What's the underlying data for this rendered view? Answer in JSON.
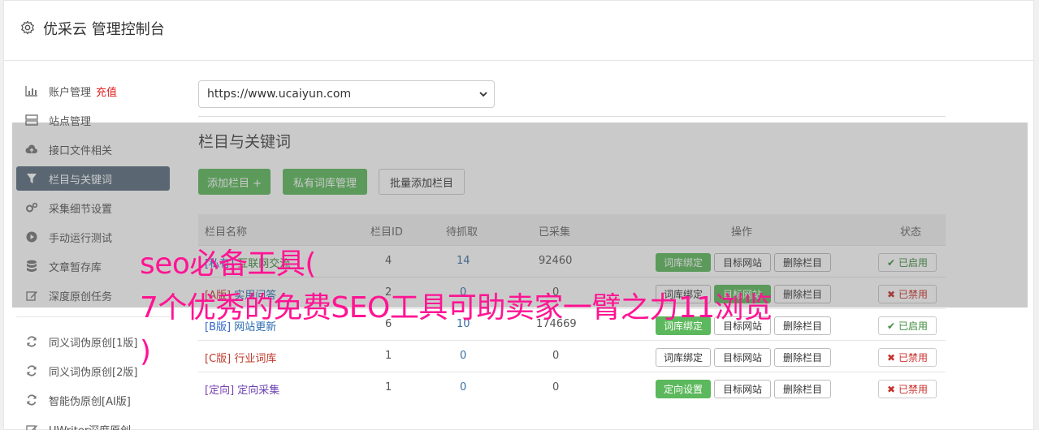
{
  "header": {
    "title": "优采云 管理控制台"
  },
  "sidebar": {
    "items": [
      {
        "label": "账户管理",
        "extra": "充值",
        "icon": "bar-chart-icon"
      },
      {
        "label": "站点管理",
        "icon": "server-icon"
      },
      {
        "label": "接口文件相关",
        "icon": "cloud-upload-icon"
      },
      {
        "label": "栏目与关键词",
        "icon": "filter-icon",
        "active": true
      },
      {
        "label": "采集细节设置",
        "icon": "gears-icon"
      },
      {
        "label": "手动运行测试",
        "icon": "play-circle-icon"
      },
      {
        "label": "文章暂存库",
        "icon": "database-icon"
      },
      {
        "label": "深度原创任务",
        "icon": "edit-icon"
      },
      {
        "label": "同义词伪原创[1版]",
        "icon": "refresh-icon"
      },
      {
        "label": "同义词伪原创[2版]",
        "icon": "refresh-icon"
      },
      {
        "label": "智能伪原创[AI版]",
        "icon": "refresh-icon"
      },
      {
        "label": "UWriter深度原创",
        "icon": "edit-icon"
      }
    ]
  },
  "site_select": {
    "value": "https://www.ucaiyun.com"
  },
  "section": {
    "title": "栏目与关键词",
    "buttons": {
      "add": "添加栏目 +",
      "private": "私有词库管理",
      "batch": "批量添加栏目"
    }
  },
  "table": {
    "headers": {
      "name": "栏目名称",
      "id": "栏目ID",
      "pending": "待抓取",
      "collected": "已采集",
      "ops": "操作",
      "status": "状态"
    },
    "rows": [
      {
        "tag": "[私有]",
        "name": "互联网交流",
        "id": "4",
        "pending": "14",
        "collected": "92460",
        "op1": "词库绑定",
        "op2": "目标网站",
        "op3": "删除栏目",
        "status": "已启用"
      },
      {
        "tag": "[A版]",
        "name": "实用问答",
        "id": "2",
        "pending": "0",
        "collected": "0",
        "op1": "词库绑定",
        "op2": "目标网站",
        "op3": "删除栏目",
        "status": "已禁用"
      },
      {
        "tag": "[B版]",
        "name": "网站更新",
        "id": "6",
        "pending": "10",
        "collected": "174669",
        "op1": "词库绑定",
        "op2": "目标网站",
        "op3": "删除栏目",
        "status": "已启用"
      },
      {
        "tag": "[C版]",
        "name": "行业词库",
        "id": "1",
        "pending": "0",
        "collected": "0",
        "op1": "词库绑定",
        "op2": "目标网站",
        "op3": "删除栏目",
        "status": "已禁用"
      },
      {
        "tag": "[定向]",
        "name": "定向采集",
        "id": "1",
        "pending": "0",
        "collected": "0",
        "op1": "定向设置",
        "op2": "目标网站",
        "op3": "删除栏目",
        "status": "已禁用"
      }
    ]
  },
  "overlay": {
    "line1": "seo必备工具(",
    "line2": "7个优秀的免费SEO工具可助卖家一臂之力11浏览",
    "line3": ")"
  }
}
